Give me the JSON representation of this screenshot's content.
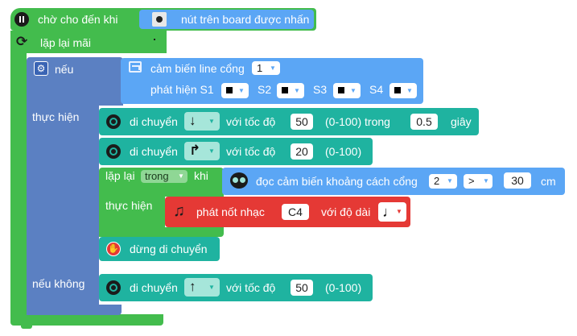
{
  "hat": {
    "label": "chờ cho đến khi",
    "condition": "nút trên board được nhấn"
  },
  "loop": {
    "label": "lặp lại mãi"
  },
  "if_block": {
    "if_label": "nếu",
    "do_label": "thực hiện",
    "else_label": "nếu không",
    "condition": {
      "text": "cảm biến line cổng",
      "port": "1",
      "detect_label": "phát hiện S1",
      "s2": "S2",
      "s3": "S3",
      "s4": "S4"
    }
  },
  "move1": {
    "label": "di chuyển",
    "dir": "↓",
    "speed_label": "với tốc độ",
    "speed": "50",
    "range": "(0-100) trong",
    "time": "0.5",
    "unit": "giây"
  },
  "move2": {
    "label": "di chuyển",
    "dir": "↱",
    "speed_label": "với tốc độ",
    "speed": "20",
    "range": "(0-100)"
  },
  "while_loop": {
    "label": "lặp lại",
    "mode": "trong",
    "when": "khi",
    "do_label": "thực hiện",
    "condition": {
      "text": "đọc cảm biến khoảng cách cổng",
      "port": "2",
      "op": ">",
      "value": "30",
      "unit": "cm"
    }
  },
  "note": {
    "label": "phát nốt nhạc",
    "note": "C4",
    "duration_label": "với độ dài",
    "duration_icon": "♩"
  },
  "stop": {
    "label": "dừng di chuyển"
  },
  "move3": {
    "label": "di chuyển",
    "dir": "↑",
    "speed_label": "với tốc độ",
    "speed": "50",
    "range": "(0-100)"
  },
  "colors": {
    "event": "#4A3AA0",
    "loop_green": "#3DB84A",
    "logic_blue": "#5B80C2",
    "sensor_blue": "#5BA6F5",
    "motion_teal": "#1FB3A0",
    "music_red": "#E53935"
  }
}
